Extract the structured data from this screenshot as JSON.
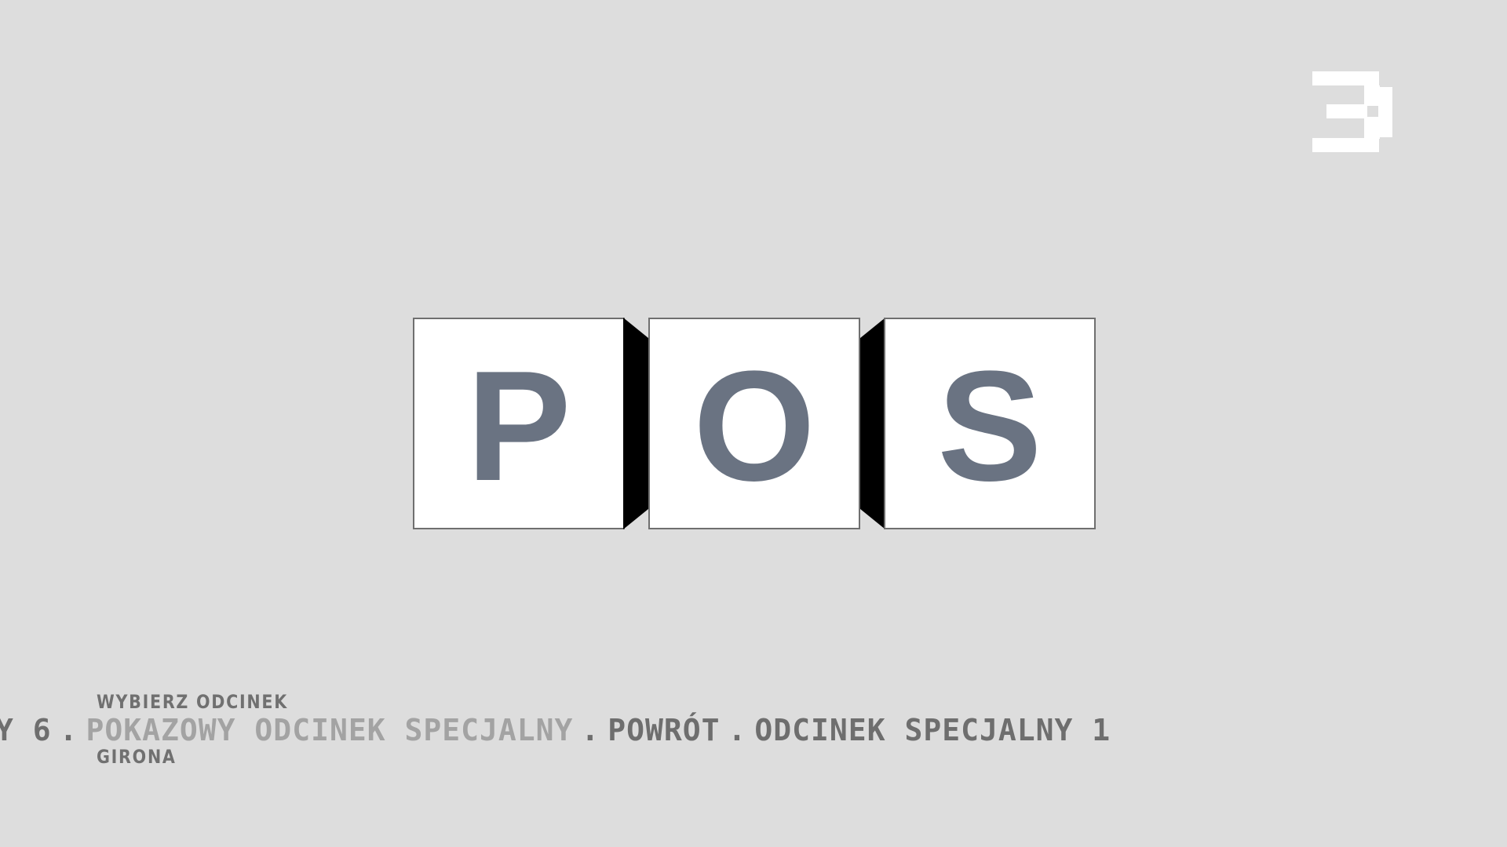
{
  "logo": {
    "icon": "pixel-e-logo-icon",
    "color": "#ffffff"
  },
  "tiles": {
    "letters": [
      "P",
      "O",
      "S"
    ],
    "letter_color": "#6a7382",
    "tile_color": "#ffffff"
  },
  "menu": {
    "section_label": "WYBIERZ ODCINEK",
    "location_label": "GIRONA",
    "items": [
      {
        "label": "Y 6",
        "active": false
      },
      {
        "label": "POKAZOWY ODCINEK SPECJALNY",
        "active": true
      },
      {
        "label": "POWRÓT",
        "active": false
      },
      {
        "label": "ODCINEK SPECJALNY 1",
        "active": false
      }
    ],
    "separator": ".",
    "active_color": "#a3a3a3",
    "inactive_color": "#6e6e6e"
  },
  "background_color": "#dddddd"
}
